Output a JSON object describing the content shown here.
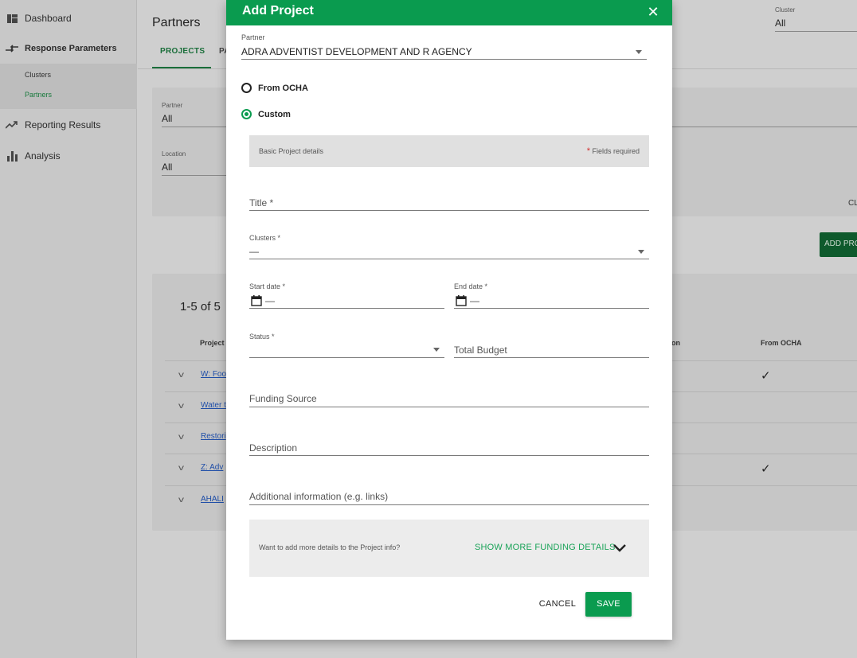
{
  "sidebar": {
    "items": [
      {
        "label": "Dashboard",
        "icon": "dashboard-icon"
      },
      {
        "label": "Response Parameters",
        "icon": "compare-arrows-icon"
      },
      {
        "label": "Reporting Results",
        "icon": "trending-up-icon"
      },
      {
        "label": "Analysis",
        "icon": "bar-chart-icon"
      }
    ],
    "sub_items": [
      "Clusters",
      "Partners"
    ]
  },
  "background": {
    "page_title": "Partners",
    "tabs": [
      "PROJECTS",
      "PA"
    ],
    "filters": {
      "partner_label": "Partner",
      "partner_value": "All",
      "location_label": "Location",
      "location_value": "All",
      "cluster_label": "Cluster",
      "cluster_value": "All"
    },
    "cl_text": "CL",
    "add_button": "ADD PRO",
    "table": {
      "count": "1-5 of 5",
      "headers": [
        "Project",
        "on",
        "From OCHA"
      ],
      "rows": [
        {
          "title": "W: Foo",
          "from_ocha": "✓"
        },
        {
          "title": "Water t",
          "from_ocha": ""
        },
        {
          "title": "Restori",
          "from_ocha": ""
        },
        {
          "title": "Z: Adv",
          "from_ocha": "✓"
        },
        {
          "title": "AHALI",
          "from_ocha": ""
        }
      ]
    }
  },
  "modal": {
    "title": "Add Project",
    "close_symbol": "✕",
    "partner_label": "Partner",
    "partner_value": "ADRA ADVENTIST DEVELOPMENT AND R AGENCY",
    "radio_from_ocha": "From OCHA",
    "radio_custom": "Custom",
    "section_left": "Basic Project details",
    "section_required_star": "*",
    "section_required_text": " Fields required",
    "title_placeholder": "Title *",
    "clusters_label": "Clusters *",
    "clusters_value": "—",
    "start_date_label": "Start date *",
    "start_date_value": "—",
    "end_date_label": "End date *",
    "end_date_value": "—",
    "status_label": "Status *",
    "total_budget_placeholder": "Total Budget",
    "funding_source_placeholder": "Funding Source",
    "description_placeholder": "Description",
    "additional_info_placeholder": "Additional information (e.g. links)",
    "funding_question": "Want to add more details to the Project info?",
    "show_more_label": "SHOW MORE FUNDING DETAILS",
    "cancel_label": "CANCEL",
    "save_label": "SAVE"
  },
  "colors": {
    "primary": "#0a9b4f",
    "link": "#1f4ea8",
    "required": "#d32f2f"
  }
}
